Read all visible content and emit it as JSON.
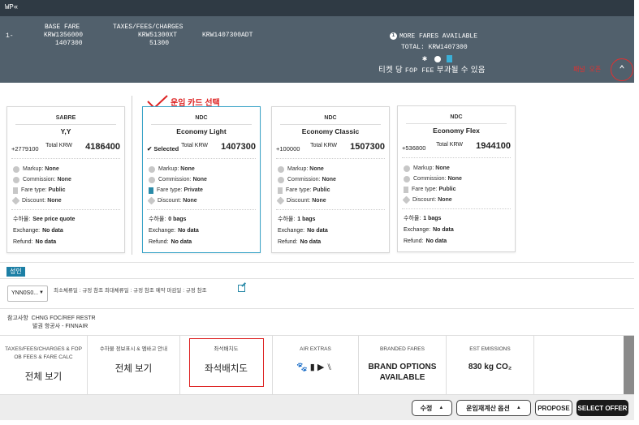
{
  "topbar": {
    "title": "WP«"
  },
  "terminal": {
    "line_num": "1-",
    "base_fare_label": "BASE FARE",
    "base_fare_value": "KRW1356000",
    "base_fare_total": "1407300",
    "taxes_label": "TAXES/FEES/CHARGES",
    "taxes_value": "KRW51300XT",
    "taxes_total": "51300",
    "grand": "KRW1407300ADT",
    "more_fares": "MORE FARES AVAILABLE",
    "total": "TOTAL:  KRW1407300",
    "hint_pre": "티켓 당",
    "hint_fop": "FOP FEE",
    "hint_post": "부과될 수 있음",
    "panel_open": "패널 오픈"
  },
  "annotation": {
    "select_card": "운임 카드 선택"
  },
  "cards": [
    {
      "source": "SABRE",
      "family": "Y,Y",
      "left": "+2779100",
      "total_label": "Total KRW",
      "total": "4186400",
      "markup": "None",
      "commission": "None",
      "fare_type": "Public",
      "discount": "None",
      "baggage": "See price quote",
      "exchange": "No data",
      "refund": "No data"
    },
    {
      "source": "NDC",
      "family": "Economy Light",
      "left": "Selected",
      "total_label": "Total KRW",
      "total": "1407300",
      "markup": "None",
      "commission": "None",
      "fare_type": "Private",
      "discount": "None",
      "baggage": "0 bags",
      "exchange": "No data",
      "refund": "No data"
    },
    {
      "source": "NDC",
      "family": "Economy Classic",
      "left": "+100000",
      "total_label": "Total KRW",
      "total": "1507300",
      "markup": "None",
      "commission": "None",
      "fare_type": "Public",
      "discount": "None",
      "baggage": "1 bags",
      "exchange": "No data",
      "refund": "No data"
    },
    {
      "source": "NDC",
      "family": "Economy Flex",
      "left": "+536800",
      "total_label": "Total KRW",
      "total": "1944100",
      "markup": "None",
      "commission": "None",
      "fare_type": "Public",
      "discount": "None",
      "baggage": "1 bags",
      "exchange": "No data",
      "refund": "No data"
    }
  ],
  "card_labels": {
    "markup": "Markup:",
    "commission": "Commission:",
    "fare_type": "Fare type:",
    "discount": "Discount:",
    "baggage": "수하물:",
    "exchange": "Exchange:",
    "refund": "Refund:"
  },
  "adult": {
    "tag": "성인",
    "select_value": "YNN0S0...",
    "rules": "최소체류일 : 규정 참조    최대체류일 : 규정 참조    예약 마감일 : 규정 참조"
  },
  "reference": {
    "label": "참고사항",
    "line1": "CHNG FOC/REF RESTR",
    "line2": "발권 항공사 - FINNAIR"
  },
  "bottom_cells": [
    {
      "header": "TAXES/FEES/CHARGES & FOP OB FEES & FARE CALC",
      "value": "전체 보기"
    },
    {
      "header": "수하물 정보표시 & 엠바고 안내",
      "value": "전체 보기"
    },
    {
      "header": "좌석배치도",
      "value": "좌석배치도"
    },
    {
      "header": "AIR EXTRAS",
      "value": ""
    },
    {
      "header": "BRANDED FARES",
      "value": "BRAND OPTIONS AVAILABLE"
    },
    {
      "header": "EST EMISSIONS",
      "value": "830 kg CO₂"
    }
  ],
  "air_extras_icons": [
    "paw-icon",
    "luggage-icon",
    "video-icon",
    "seat-icon"
  ],
  "footer": {
    "edit": "수정",
    "recalc": "운임재계산 옵션",
    "propose": "PROPOSE",
    "select_offer": "SELECT OFFER"
  },
  "colors": {
    "accent": "#1c7fa5",
    "panel": "#51606c",
    "annotation": "#d22222"
  }
}
